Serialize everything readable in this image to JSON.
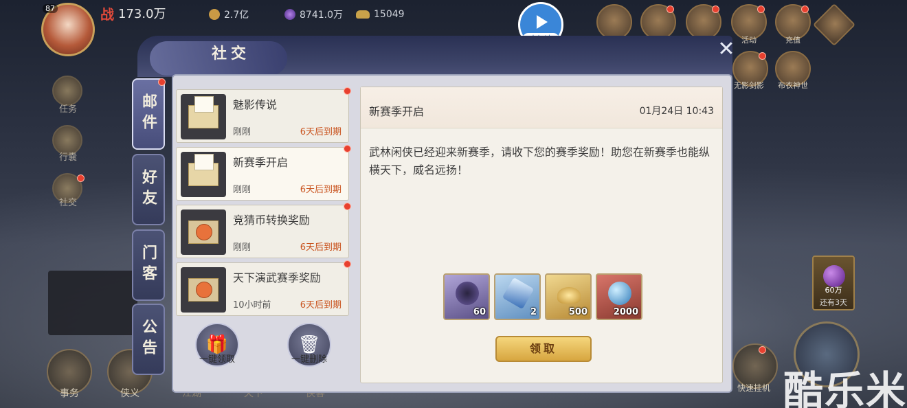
{
  "topbar": {
    "level": "87",
    "power_label": "战",
    "power_value": "173.0万",
    "coins": "2.7亿",
    "gems": "8741.0万",
    "ingots": "15049"
  },
  "accelerate": {
    "label": "未加速"
  },
  "right_icons": [
    {
      "label": "活动"
    },
    {
      "label": "充值"
    },
    {
      "label": "无影剑影"
    },
    {
      "label": "布衣神世"
    }
  ],
  "background_menu": [
    {
      "label": "任务"
    },
    {
      "label": "行囊"
    },
    {
      "label": "社交"
    }
  ],
  "side_reward": {
    "value": "60万",
    "time_label": "还有3天"
  },
  "bottom_menu": [
    {
      "label": "事务"
    },
    {
      "label": "侠义"
    },
    {
      "label": "江湖"
    },
    {
      "label": "天下"
    },
    {
      "label": "侠客"
    },
    {
      "label": "快速挂机"
    }
  ],
  "watermark": "酷乐米",
  "dialog": {
    "title": "社交",
    "tabs": [
      {
        "label": "邮件",
        "active": true,
        "badge": true
      },
      {
        "label": "好友",
        "active": false,
        "badge": false
      },
      {
        "label": "门客",
        "active": false,
        "badge": false
      },
      {
        "label": "公告",
        "active": false,
        "badge": false
      }
    ],
    "mails": [
      {
        "title": "魅影传说",
        "time": "刚刚",
        "expire": "6天后到期",
        "type": "letter"
      },
      {
        "title": "新赛季开启",
        "time": "刚刚",
        "expire": "6天后到期",
        "type": "letter"
      },
      {
        "title": "竞猜币转换奖励",
        "time": "刚刚",
        "expire": "6天后到期",
        "type": "gift"
      },
      {
        "title": "天下演武赛季奖励",
        "time": "10小时前",
        "expire": "6天后到期",
        "type": "gift"
      }
    ],
    "bulk": {
      "claim_all": "一键领取",
      "delete_all": "一键删除"
    },
    "detail": {
      "title": "新赛季开启",
      "date": "01月24日 10:43",
      "body": "武林闲侠已经迎来新赛季，请收下您的赛季奖励！助您在新赛季也能纵横天下，威名远扬！",
      "rewards": [
        {
          "icon": "hero-fragment-icon",
          "count": "60"
        },
        {
          "icon": "crystal-icon",
          "count": "2"
        },
        {
          "icon": "gold-ingot-icon",
          "count": "500"
        },
        {
          "icon": "orb-icon",
          "count": "2000"
        }
      ],
      "claim_label": "领取"
    }
  }
}
